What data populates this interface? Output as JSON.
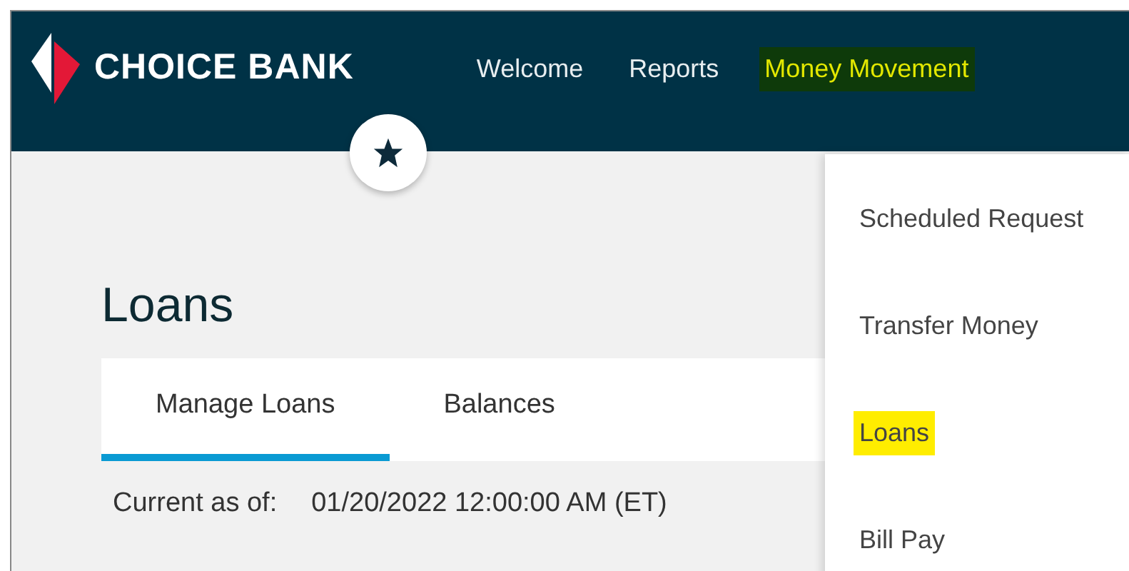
{
  "brand": {
    "name": "CHOICE BANK"
  },
  "nav": [
    {
      "label": "Welcome",
      "highlighted": false
    },
    {
      "label": "Reports",
      "highlighted": false
    },
    {
      "label": "Money Movement",
      "highlighted": true
    }
  ],
  "page": {
    "title": "Loans"
  },
  "tabs": [
    {
      "label": "Manage Loans",
      "selected": true
    },
    {
      "label": "Balances",
      "selected": false
    }
  ],
  "current_as_of": {
    "label": "Current as of:",
    "value": "01/20/2022 12:00:00 AM (ET)"
  },
  "dropdown": [
    {
      "label": "Scheduled Request",
      "highlighted": false
    },
    {
      "label": "Transfer Money",
      "highlighted": false
    },
    {
      "label": "Loans",
      "highlighted": true
    },
    {
      "label": "Bill Pay",
      "highlighted": false
    }
  ]
}
